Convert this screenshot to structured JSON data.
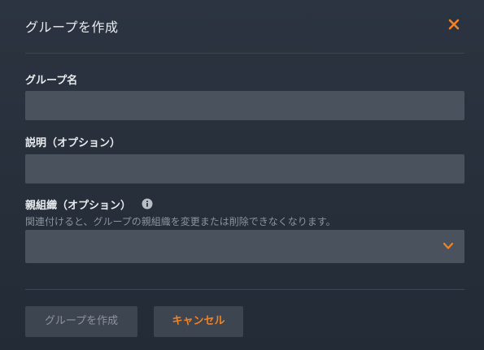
{
  "dialog": {
    "title": "グループを作成",
    "close_icon": "close-icon",
    "accent_color": "#f58220"
  },
  "form": {
    "group_name": {
      "label": "グループ名",
      "value": "",
      "placeholder": ""
    },
    "description": {
      "label": "説明（オプション）",
      "value": "",
      "placeholder": ""
    },
    "parent_org": {
      "label": "親組織（オプション）",
      "info_icon": "info-icon",
      "help_text": "関連付けると、グループの親組織を変更または削除できなくなります。",
      "selected_value": "",
      "dropdown_icon": "chevron-down-icon"
    }
  },
  "footer": {
    "create_label": "グループを作成",
    "cancel_label": "キャンセル"
  }
}
